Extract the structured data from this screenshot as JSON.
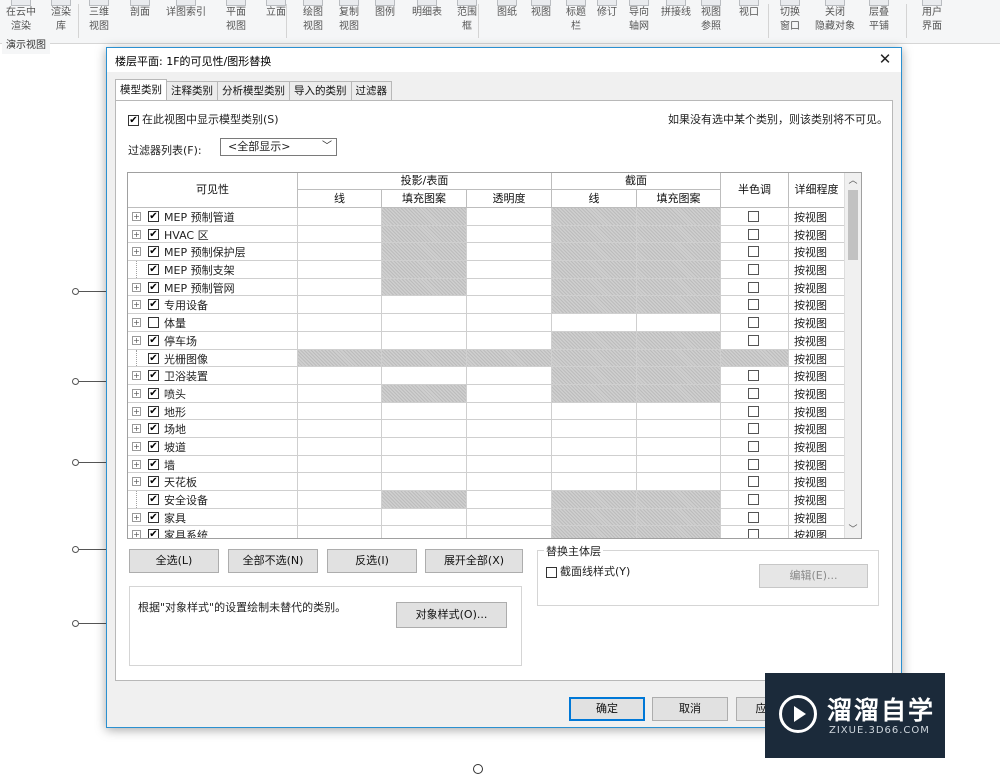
{
  "ribbon": {
    "buttons": [
      {
        "label": "在云中\n渲染"
      },
      {
        "label": "渲染\n库"
      },
      {
        "label": "三维\n视图"
      },
      {
        "label": "剖面"
      },
      {
        "label": "详图索引"
      },
      {
        "label": "平面\n视图"
      },
      {
        "label": "立面"
      },
      {
        "label": "绘图\n视图"
      },
      {
        "label": "复制\n视图"
      },
      {
        "label": "图例"
      },
      {
        "label": "明细表"
      },
      {
        "label": "范围\n框"
      },
      {
        "label": "图纸"
      },
      {
        "label": "视图"
      },
      {
        "label": "标题\n栏"
      },
      {
        "label": "修订"
      },
      {
        "label": "导向\n轴网"
      },
      {
        "label": "拼接线"
      },
      {
        "label": "视图\n参照"
      },
      {
        "label": "视口"
      },
      {
        "label": "切换\n窗口"
      },
      {
        "label": "关闭\n隐藏对象"
      },
      {
        "label": "层叠\n平铺"
      },
      {
        "label": "用户\n界面"
      }
    ],
    "group_label": "演示视图"
  },
  "dialog": {
    "title": "楼层平面: 1F的可见性/图形替换",
    "tabs": [
      {
        "label": "模型类别",
        "active": true
      },
      {
        "label": "注释类别",
        "active": false
      },
      {
        "label": "分析模型类别",
        "active": false
      },
      {
        "label": "导入的类别",
        "active": false
      },
      {
        "label": "过滤器",
        "active": false
      }
    ],
    "show_model_label": "在此视图中显示模型类别(S)",
    "hint": "如果没有选中某个类别，则该类别将不可见。",
    "filter_label": "过滤器列表(F):",
    "filter_value": "<全部显示>",
    "columns": {
      "visibility": "可见性",
      "projection": "投影/表面",
      "proj_line": "线",
      "proj_pattern": "填充图案",
      "proj_transparency": "透明度",
      "cut": "截面",
      "cut_line": "线",
      "cut_pattern": "填充图案",
      "halftone": "半色调",
      "detail_level": "详细程度"
    },
    "rows": [
      {
        "name": "MEP 预制管道",
        "expander": true,
        "checked": true,
        "hatch": [
          false,
          true,
          false,
          true,
          true
        ],
        "detail": "按视图"
      },
      {
        "name": "HVAC 区",
        "expander": true,
        "checked": true,
        "hatch": [
          false,
          true,
          false,
          true,
          true
        ],
        "detail": "按视图"
      },
      {
        "name": "MEP 预制保护层",
        "expander": true,
        "checked": true,
        "hatch": [
          false,
          true,
          false,
          true,
          true
        ],
        "detail": "按视图"
      },
      {
        "name": "MEP 预制支架",
        "expander": false,
        "checked": true,
        "hatch": [
          false,
          true,
          false,
          true,
          true
        ],
        "detail": "按视图"
      },
      {
        "name": "MEP 预制管网",
        "expander": true,
        "checked": true,
        "hatch": [
          false,
          true,
          false,
          true,
          true
        ],
        "detail": "按视图"
      },
      {
        "name": "专用设备",
        "expander": true,
        "checked": true,
        "hatch": [
          false,
          false,
          false,
          true,
          true
        ],
        "detail": "按视图"
      },
      {
        "name": "体量",
        "expander": true,
        "checked": false,
        "hatch": [
          false,
          false,
          false,
          false,
          false
        ],
        "detail": "按视图"
      },
      {
        "name": "停车场",
        "expander": true,
        "checked": true,
        "hatch": [
          false,
          false,
          false,
          true,
          true
        ],
        "detail": "按视图"
      },
      {
        "name": "光栅图像",
        "expander": false,
        "checked": true,
        "hatch": [
          true,
          true,
          true,
          true,
          true
        ],
        "halftone_hatch": true,
        "detail": "按视图"
      },
      {
        "name": "卫浴装置",
        "expander": true,
        "checked": true,
        "hatch": [
          false,
          false,
          false,
          true,
          true
        ],
        "detail": "按视图"
      },
      {
        "name": "喷头",
        "expander": true,
        "checked": true,
        "hatch": [
          false,
          true,
          false,
          true,
          true
        ],
        "detail": "按视图"
      },
      {
        "name": "地形",
        "expander": true,
        "checked": true,
        "hatch": [
          false,
          false,
          false,
          false,
          false
        ],
        "detail": "按视图"
      },
      {
        "name": "场地",
        "expander": true,
        "checked": true,
        "hatch": [
          false,
          false,
          false,
          false,
          false
        ],
        "detail": "按视图"
      },
      {
        "name": "坡道",
        "expander": true,
        "checked": true,
        "hatch": [
          false,
          false,
          false,
          false,
          false
        ],
        "detail": "按视图"
      },
      {
        "name": "墙",
        "expander": true,
        "checked": true,
        "hatch": [
          false,
          false,
          false,
          false,
          false
        ],
        "detail": "按视图"
      },
      {
        "name": "天花板",
        "expander": true,
        "checked": true,
        "hatch": [
          false,
          false,
          false,
          false,
          false
        ],
        "detail": "按视图"
      },
      {
        "name": "安全设备",
        "expander": false,
        "checked": true,
        "hatch": [
          false,
          true,
          false,
          true,
          true
        ],
        "detail": "按视图"
      },
      {
        "name": "家具",
        "expander": true,
        "checked": true,
        "hatch": [
          false,
          false,
          false,
          true,
          true
        ],
        "detail": "按视图"
      },
      {
        "name": "家具系统",
        "expander": true,
        "checked": true,
        "hatch": [
          false,
          false,
          false,
          true,
          true
        ],
        "detail": "按视图"
      }
    ],
    "buttons": {
      "select_all": "全选(L)",
      "select_none": "全部不选(N)",
      "invert": "反选(I)",
      "expand_all": "展开全部(X)",
      "object_styles": "对象样式(O)...",
      "edit": "编辑(E)...",
      "ok": "确定",
      "cancel": "取消",
      "apply": "应"
    },
    "override_host_title": "替换主体层",
    "override_host_checkbox": "截面线样式(Y)",
    "style_note": "根据\"对象样式\"的设置绘制未替代的类别。"
  },
  "watermark": {
    "name": "溜溜自学",
    "url": "ZIXUE.3D66.COM"
  }
}
